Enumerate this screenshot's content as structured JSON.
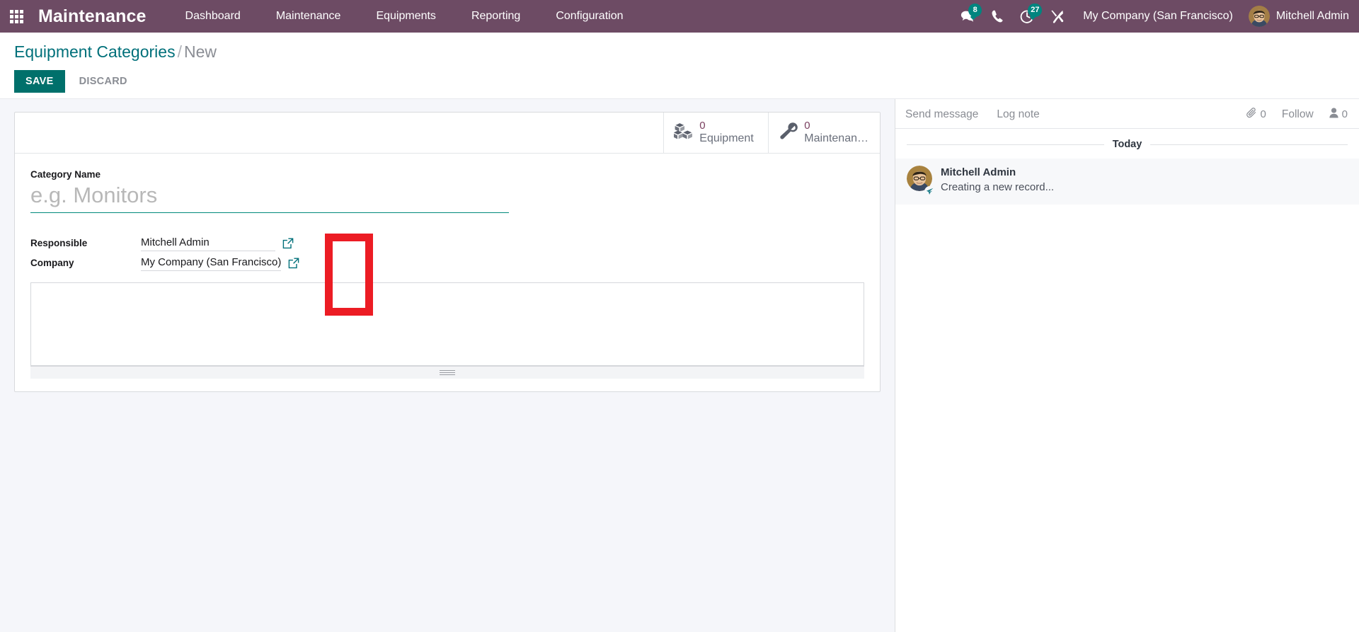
{
  "navbar": {
    "apps_icon": "apps-grid-icon",
    "brand": "Maintenance",
    "menu": [
      {
        "label": "Dashboard"
      },
      {
        "label": "Maintenance"
      },
      {
        "label": "Equipments"
      },
      {
        "label": "Reporting"
      },
      {
        "label": "Configuration"
      }
    ],
    "messages_icon": "chat-bubble-icon",
    "messages_count": "8",
    "phone_icon": "phone-icon",
    "activities_icon": "clock-activity-icon",
    "activities_count": "27",
    "tools_icon": "wrench-screwdriver-icon",
    "company": "My Company (San Francisco)",
    "user_name": "Mitchell Admin",
    "avatar_icon": "user-avatar",
    "bg_color": "#6d4b64",
    "badge_color": "#00857f"
  },
  "control_panel": {
    "breadcrumb_root": "Equipment Categories",
    "breadcrumb_separator": "/",
    "breadcrumb_current": "New",
    "save_label": "SAVE",
    "discard_label": "DISCARD",
    "save_color": "#00706b"
  },
  "form": {
    "stat_buttons": [
      {
        "icon": "boxes-icon",
        "value": "0",
        "label": "Equipment"
      },
      {
        "icon": "wrench-icon",
        "value": "0",
        "label": "Maintenan…"
      }
    ],
    "title_field": {
      "label": "Category Name",
      "value": "",
      "placeholder": "e.g. Monitors",
      "underline_color": "#00897b"
    },
    "fields": [
      {
        "label": "Responsible",
        "value": "Mitchell Admin",
        "external_link_icon": "external-link-icon"
      },
      {
        "label": "Company",
        "value": "My Company (San Francisco)",
        "external_link_icon": "external-link-icon"
      }
    ],
    "notes": {
      "value": "",
      "resize_handle_icon": "resize-grip-icon"
    },
    "annotation": {
      "type": "highlight-rectangle",
      "color": "#ec1c24"
    }
  },
  "chatter": {
    "send_message_label": "Send message",
    "log_note_label": "Log note",
    "attachment_icon": "paperclip-icon",
    "attachment_count": "0",
    "follow_label": "Follow",
    "followers_icon": "person-icon",
    "followers_count": "0",
    "date_separator": "Today",
    "messages": [
      {
        "author": "Mitchell Admin",
        "body": "Creating a new record...",
        "avatar_icon": "user-avatar",
        "badge_icon": "pin-icon"
      }
    ]
  }
}
